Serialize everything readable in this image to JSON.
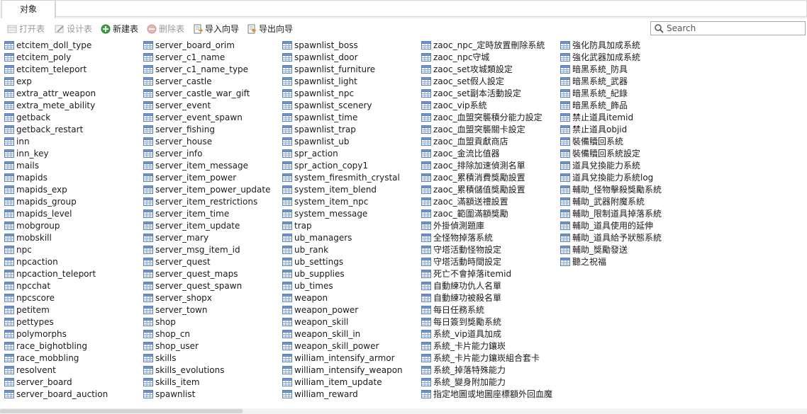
{
  "tabs": {
    "objects_tab": "对象"
  },
  "toolbar": {
    "open_table": "打开表",
    "design_table": "设计表",
    "new_table": "新建表",
    "delete_table": "删除表",
    "import_wizard": "导入向导",
    "export_wizard": "导出向导"
  },
  "search": {
    "placeholder": "Search"
  },
  "colors": {
    "table_icon_border": "#5a7fb5",
    "table_icon_header": "#6f93c6",
    "new_icon": "#3aa33a",
    "delete_icon": "#d9534f"
  },
  "icons": {
    "open_table": "open-table-icon",
    "design_table": "design-table-icon",
    "new_table": "new-table-icon",
    "delete_table": "delete-table-icon",
    "import_wizard": "import-wizard-icon",
    "export_wizard": "export-wizard-icon",
    "search": "search-icon",
    "table": "table-icon"
  },
  "columns": [
    [
      "etcitem_doll_type",
      "etcitem_poly",
      "etcitem_teleport",
      "exp",
      "extra_attr_weapon",
      "extra_mete_ability",
      "getback",
      "getback_restart",
      "inn",
      "inn_key",
      "mails",
      "mapids",
      "mapids_exp",
      "mapids_group",
      "mapids_level",
      "mobgroup",
      "mobskill",
      "npc",
      "npcaction",
      "npcaction_teleport",
      "npcchat",
      "npcscore",
      "petitem",
      "pettypes",
      "polymorphs",
      "race_bighotbling",
      "race_mobbling",
      "resolvent",
      "server_board",
      "server_board_auction"
    ],
    [
      "server_board_orim",
      "server_c1_name",
      "server_c1_name_type",
      "server_castle",
      "server_castle_war_gift",
      "server_event",
      "server_event_spawn",
      "server_fishing",
      "server_house",
      "server_info",
      "server_item_message",
      "server_item_power",
      "server_item_power_update",
      "server_item_restrictions",
      "server_item_time",
      "server_item_update",
      "server_mary",
      "server_msg_item_id",
      "server_quest",
      "server_quest_maps",
      "server_quest_spawn",
      "server_shopx",
      "server_town",
      "shop",
      "shop_cn",
      "shop_user",
      "skills",
      "skills_evolutions",
      "skills_item",
      "spawnlist"
    ],
    [
      "spawnlist_boss",
      "spawnlist_door",
      "spawnlist_furniture",
      "spawnlist_light",
      "spawnlist_npc",
      "spawnlist_scenery",
      "spawnlist_time",
      "spawnlist_trap",
      "spawnlist_ub",
      "spr_action",
      "spr_action_copy1",
      "system_firesmith_crystal",
      "system_item_blend",
      "system_item_npc",
      "system_message",
      "trap",
      "ub_managers",
      "ub_rank",
      "ub_settings",
      "ub_supplies",
      "ub_times",
      "weapon",
      "weapon_power",
      "weapon_skill",
      "weapon_skill_in",
      "weapon_skill_power",
      "william_intensify_armor",
      "william_intensify_weapon",
      "william_item_update",
      "william_reward"
    ],
    [
      "zaoc_npc_定時放置刪除系統",
      "zaoc_npc守城",
      "zaoc_set攻城類設定",
      "zaoc_set假人設定",
      "zaoc_set副本活動設定",
      "zaoc_vip系統",
      "zaoc_血盟突襲積分能力設定",
      "zaoc_血盟突襲關卡設定",
      "zaoc_血盟貢獻商店",
      "zaoc_金流比值器",
      "zaoc_排除加速偵測名單",
      "zaoc_累積消費獎勵設置",
      "zaoc_累積儲值獎勵設置",
      "zaoc_滿額送禮設置",
      "zaoc_範圍滿額獎勵",
      "外掛偵測題庫",
      "全怪物掉落系統",
      "守塔活動怪物設定",
      "守塔活動時間設定",
      "死亡不會掉落itemid",
      "自動練功仇人名單",
      "自動練功被殺名單",
      "每日任務系統",
      "每日簽到獎勵系統",
      "系統_vip道具加成",
      "系統_卡片能力鑲崁",
      "系統_卡片能力鑲崁組合套卡",
      "系統_掉落特殊能力",
      "系統_變身附加能力",
      "指定地圖或地圖座標額外回血魔"
    ],
    [
      "強化防具加成系統",
      "強化武器加成系統",
      "暗黑系統_防具",
      "暗黑系統_武器",
      "暗黑系統_紀錄",
      "暗黑系統_飾品",
      "禁止道具itemid",
      "禁止道具objid",
      "裝備贖回系統",
      "裝備贖回系統設定",
      "道具兌換能力系統",
      "道具兌換能力系統log",
      "輔助_怪物擊殺獎勵系統",
      "輔助_武器附魔系統",
      "輔助_限制道具掉落系統",
      "輔助_道具使用的延伸",
      "輔助_道具給予狀態系統",
      "輔助_獎勵發送",
      "聽之祝福"
    ]
  ]
}
